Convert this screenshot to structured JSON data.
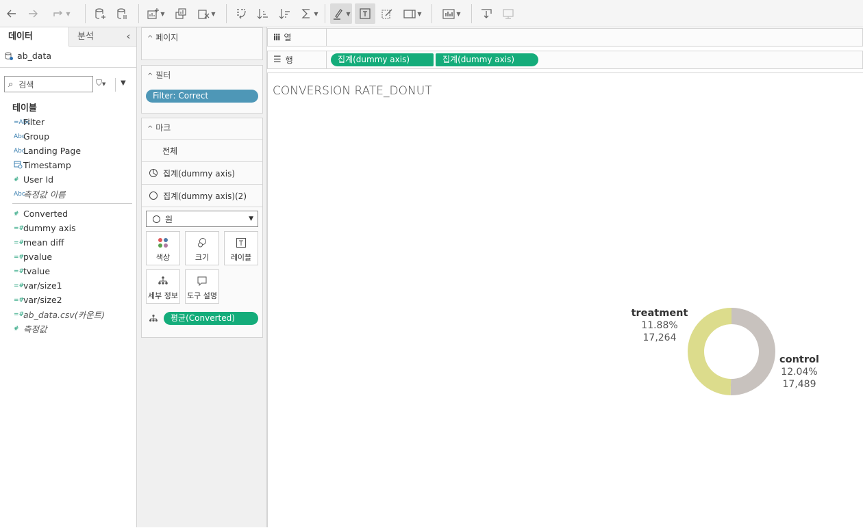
{
  "toolbar": {
    "buttons": [
      {
        "name": "undo-icon"
      },
      {
        "name": "redo-icon"
      },
      {
        "name": "replay-icon"
      },
      {
        "name": "new-data-source-icon"
      },
      {
        "name": "pause-updates-icon"
      },
      {
        "name": "new-worksheet-icon"
      },
      {
        "name": "duplicate-icon"
      },
      {
        "name": "clear-sheet-icon"
      },
      {
        "name": "swap-icon"
      },
      {
        "name": "sort-ascending-icon"
      },
      {
        "name": "sort-descending-icon"
      },
      {
        "name": "totals-icon"
      },
      {
        "name": "highlight-icon"
      },
      {
        "name": "show-labels-icon"
      },
      {
        "name": "format-workbook-icon"
      },
      {
        "name": "fit-icon"
      },
      {
        "name": "show-me-icon"
      },
      {
        "name": "download-icon"
      },
      {
        "name": "presentation-icon"
      }
    ]
  },
  "left": {
    "tabs": {
      "data": "데이터",
      "analysis": "분석",
      "collapse": "‹"
    },
    "datasource": "ab_data",
    "search_placeholder": "검색",
    "tables_header": "테이블",
    "dimensions": [
      {
        "icon": "=Abc",
        "label": "Filter",
        "italic": false
      },
      {
        "icon": "Abc",
        "label": "Group",
        "italic": false
      },
      {
        "icon": "Abc",
        "label": "Landing Page",
        "italic": false
      },
      {
        "icon": "date",
        "label": "Timestamp",
        "italic": false
      },
      {
        "icon": "#",
        "label": "User Id",
        "italic": false
      },
      {
        "icon": "Abc",
        "label": "측정값 이름",
        "italic": true
      }
    ],
    "measures": [
      {
        "icon": "#",
        "label": "Converted",
        "italic": false
      },
      {
        "icon": "=#",
        "label": "dummy axis",
        "italic": false
      },
      {
        "icon": "=#",
        "label": "mean diff",
        "italic": false
      },
      {
        "icon": "=#",
        "label": "pvalue",
        "italic": false
      },
      {
        "icon": "=#",
        "label": "tvalue",
        "italic": false
      },
      {
        "icon": "=#",
        "label": "var/size1",
        "italic": false
      },
      {
        "icon": "=#",
        "label": "var/size2",
        "italic": false
      },
      {
        "icon": "=#",
        "label": "ab_data.csv(카운트)",
        "italic": true
      },
      {
        "icon": "#",
        "label": "측정값",
        "italic": true
      }
    ]
  },
  "cards": {
    "pages": "페이지",
    "filters": "필터",
    "filter_pill": "Filter: Correct",
    "marks": "마크",
    "marks_all": "전체",
    "marks_layer1": "집계(dummy axis)",
    "marks_layer2": "집계(dummy axis)(2)",
    "mark_type": "원",
    "color": "색상",
    "size": "크기",
    "label": "레이블",
    "detail": "세부 정보",
    "tooltip": "도구 설명",
    "detail_pill": "평균(Converted)"
  },
  "shelves": {
    "columns": "열",
    "rows": "행",
    "row_pill_1": "집계(dummy axis)",
    "row_pill_2": "집계(dummy axis)"
  },
  "view": {
    "title": "CONVERSION RATE_DONUT"
  },
  "chart_data": {
    "type": "pie",
    "title": "CONVERSION RATE_DONUT",
    "slices": [
      {
        "name": "control",
        "percent_label": "12.04%",
        "count_label": "17,489",
        "value": 17489,
        "color": "#c8c2be"
      },
      {
        "name": "treatment",
        "percent_label": "11.88%",
        "count_label": "17,264",
        "value": 17264,
        "color": "#dcdc8c"
      }
    ]
  },
  "colors": {
    "accent_green": "#14ac7a",
    "filter_pill": "#4e97b7",
    "control": "#c8c2be",
    "treatment": "#dcdc8c"
  }
}
